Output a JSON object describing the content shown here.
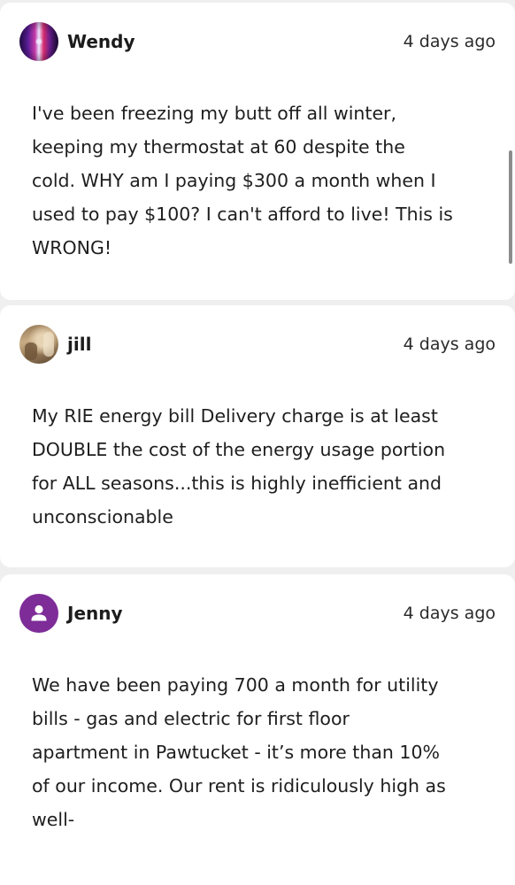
{
  "comments": [
    {
      "author": "Wendy",
      "avatar": "photo-avatar",
      "time": "4 days ago",
      "text": "I've been freezing my butt off all winter,\nkeeping my thermostat at 60 despite the\ncold. WHY am I paying $300 a month when I\nused to pay $100? I can't afford to live! This is\nWRONG!"
    },
    {
      "author": "jill",
      "avatar": "photo-avatar",
      "time": "4 days ago",
      "text": "My RIE energy bill Delivery charge is at least\nDOUBLE the cost of the energy usage portion\nfor ALL seasons...this is highly inefficient and\nunconscionable"
    },
    {
      "author": "Jenny",
      "avatar": "person-icon",
      "avatar_color": "#7e2c98",
      "time": "4 days ago",
      "text": "We have been paying 700 a month for utility\nbills - gas and electric for first floor\napartment in Pawtucket - it’s more than 10%\nof our income. Our rent is ridiculously high as\nwell-"
    }
  ]
}
